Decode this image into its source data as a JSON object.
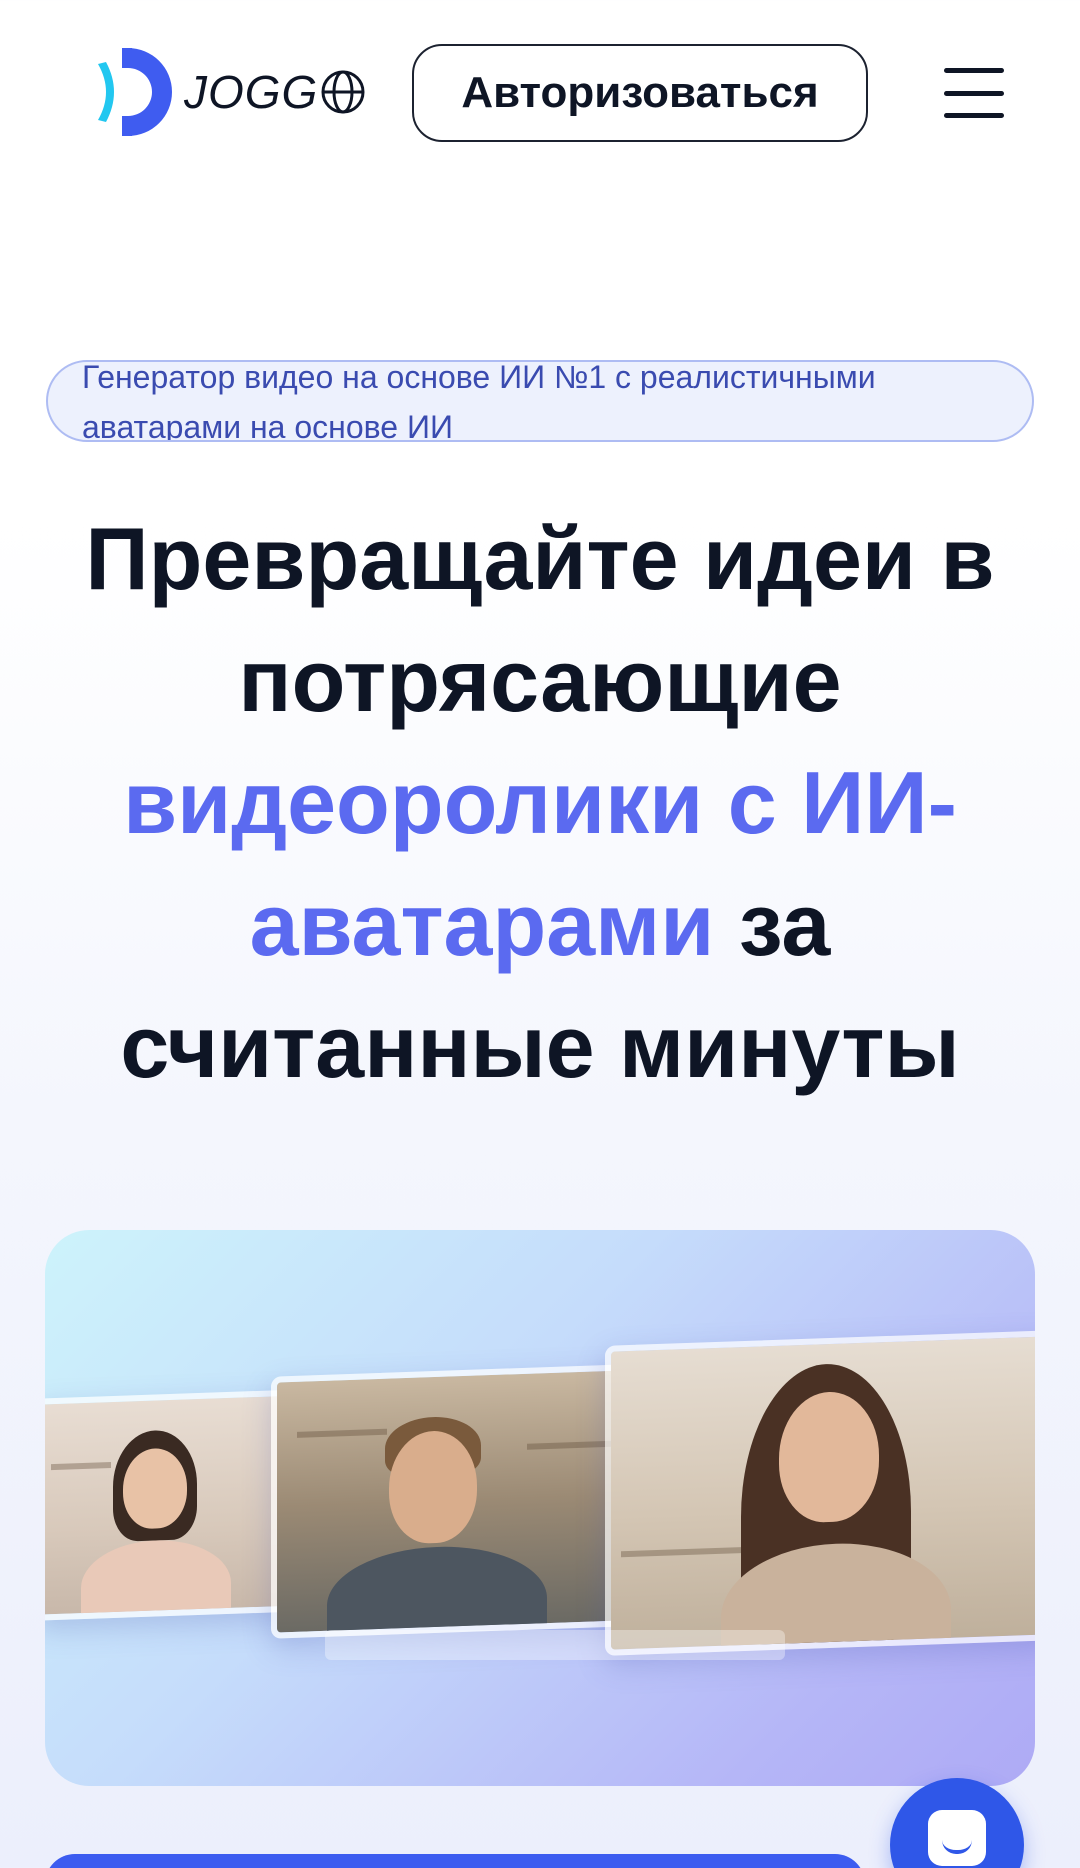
{
  "header": {
    "logo_text": "JOGG",
    "login_label": "Авторизоваться",
    "menu_icon": "hamburger-menu-icon",
    "globe_icon": "globe-icon"
  },
  "badge": {
    "text": "Генератор видео на основе ИИ №1 с реалистичными аватарами на основе ИИ"
  },
  "headline": {
    "part1": "Превращайте идеи в потрясающие",
    "accent": "видеоролики с ИИ-аватарами",
    "part2": "за считанные минуты"
  },
  "colors": {
    "accent": "#5b6af0",
    "brand_blue": "#2f57e8",
    "logo_cyan": "#22c7f0",
    "logo_blue": "#3f5cf0"
  },
  "chat": {
    "icon": "chat-icon"
  }
}
